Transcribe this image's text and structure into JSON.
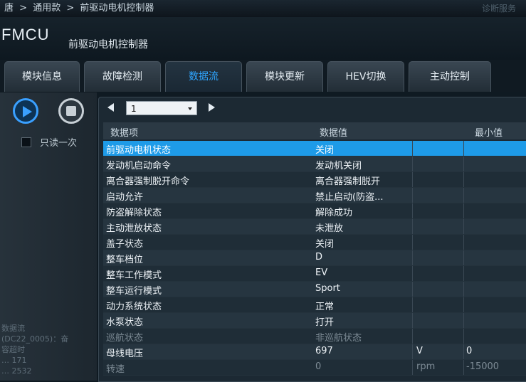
{
  "breadcrumb": {
    "items": [
      "唐",
      ">",
      "通用款",
      ">",
      "前驱动电机控制器"
    ],
    "right_text": "诊断服务"
  },
  "app": {
    "abbr": "FMCU",
    "full_name": "前驱动电机控制器"
  },
  "tabs": [
    {
      "label": "模块信息"
    },
    {
      "label": "故障检测"
    },
    {
      "label": "数据流",
      "active": true
    },
    {
      "label": "模块更新"
    },
    {
      "label": "HEV切换"
    },
    {
      "label": "主动控制"
    }
  ],
  "controls": {
    "read_once_label": "只读一次",
    "page_value": "1"
  },
  "left_info": {
    "line1": "数据流",
    "line2": "(DC22_0005)：奋",
    "line3": "容超时",
    "line4": "…  171",
    "line5": "…  2532"
  },
  "table": {
    "headers": [
      "数据项",
      "数据值",
      "最小值"
    ],
    "rows": [
      {
        "name": "前驱动电机状态",
        "value": "关闭",
        "unit": "",
        "min": ""
      },
      {
        "name": "发动机启动命令",
        "value": "发动机关闭",
        "unit": "",
        "min": ""
      },
      {
        "name": "离合器强制脱开命令",
        "value": "离合器强制脱开",
        "unit": "",
        "min": ""
      },
      {
        "name": "启动允许",
        "value": "禁止启动(防盗...",
        "unit": "",
        "min": ""
      },
      {
        "name": "防盗解除状态",
        "value": "解除成功",
        "unit": "",
        "min": ""
      },
      {
        "name": "主动泄放状态",
        "value": "未泄放",
        "unit": "",
        "min": ""
      },
      {
        "name": "盖子状态",
        "value": "关闭",
        "unit": "",
        "min": ""
      },
      {
        "name": "整车档位",
        "value": "D",
        "unit": "",
        "min": ""
      },
      {
        "name": "整车工作模式",
        "value": "EV",
        "unit": "",
        "min": ""
      },
      {
        "name": "整车运行模式",
        "value": "Sport",
        "unit": "",
        "min": ""
      },
      {
        "name": "动力系统状态",
        "value": "正常",
        "unit": "",
        "min": ""
      },
      {
        "name": "水泵状态",
        "value": "打开",
        "unit": "",
        "min": ""
      },
      {
        "name": "巡航状态",
        "value": "非巡航状态",
        "unit": "",
        "min": ""
      },
      {
        "name": "母线电压",
        "value": "697",
        "unit": "V",
        "min": "0"
      },
      {
        "name": "转速",
        "value": "0",
        "unit": "rpm",
        "min": "-15000"
      }
    ]
  },
  "colors": {
    "accent": "#2fa6ff",
    "selected_row": "#1e9be8",
    "background": "#0f1a22"
  }
}
